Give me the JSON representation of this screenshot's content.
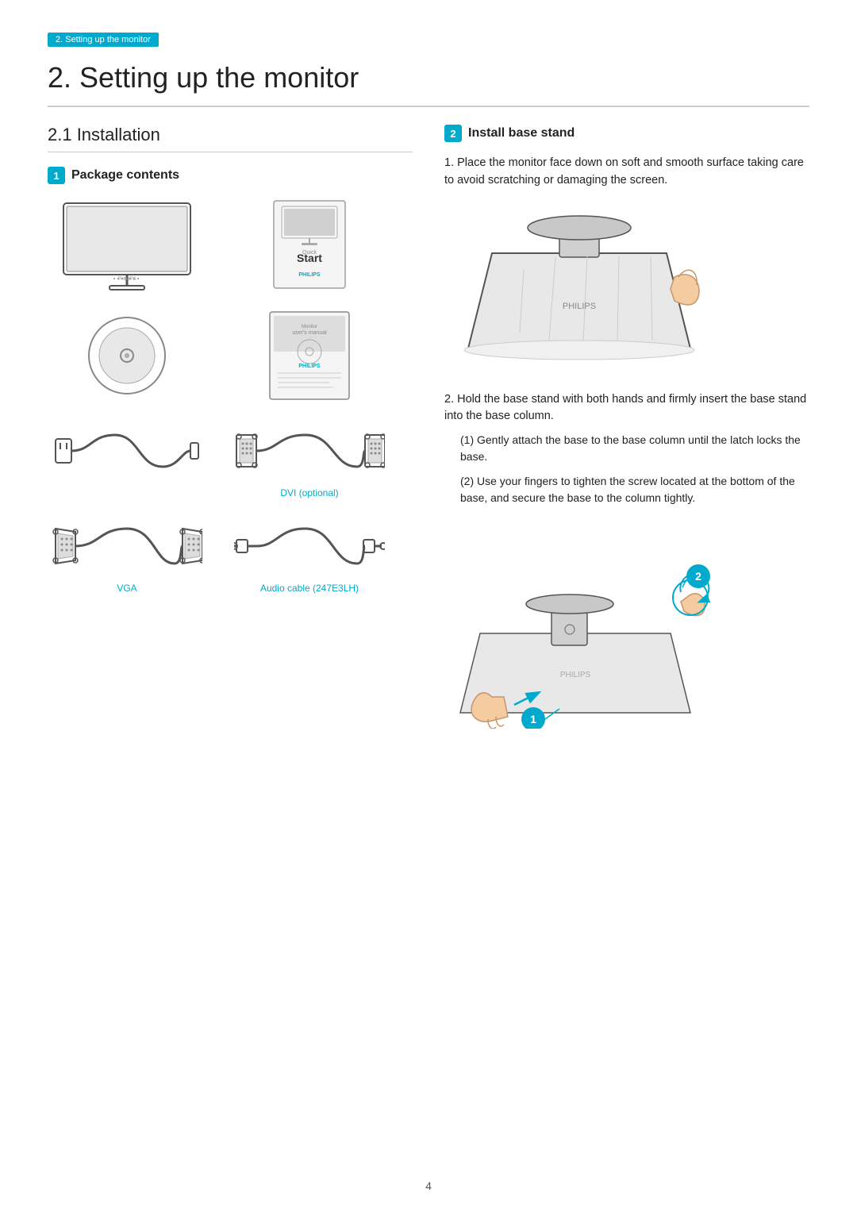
{
  "breadcrumb": "2. Setting up the monitor",
  "main_title": "2.  Setting up the monitor",
  "section_title": "2.1  Installation",
  "package_badge": "1",
  "package_label": "Package contents",
  "install_badge": "2",
  "install_label": "Install base stand",
  "items": [
    {
      "id": "monitor",
      "caption": ""
    },
    {
      "id": "quickstart",
      "caption": ""
    },
    {
      "id": "cd",
      "caption": ""
    },
    {
      "id": "disc",
      "caption": ""
    },
    {
      "id": "power_cable",
      "caption": ""
    },
    {
      "id": "dvi_cable",
      "caption": "DVI (optional)"
    },
    {
      "id": "vga_cable",
      "caption": "VGA"
    },
    {
      "id": "audio_cable",
      "caption": "Audio cable (247E3LH)"
    }
  ],
  "instructions": [
    {
      "num": "1.",
      "text": "Place the monitor face down on soft and smooth surface taking care to avoid scratching or damaging the screen."
    },
    {
      "num": "2.",
      "text": "Hold the base stand with both hands and firmly insert the base stand into the base column.",
      "sub": [
        "(1) Gently attach the base to the base column until the latch locks the base.",
        "(2) Use your fingers to tighten the screw located at the bottom of the base, and secure the base to the column tightly."
      ]
    }
  ],
  "page_number": "4"
}
